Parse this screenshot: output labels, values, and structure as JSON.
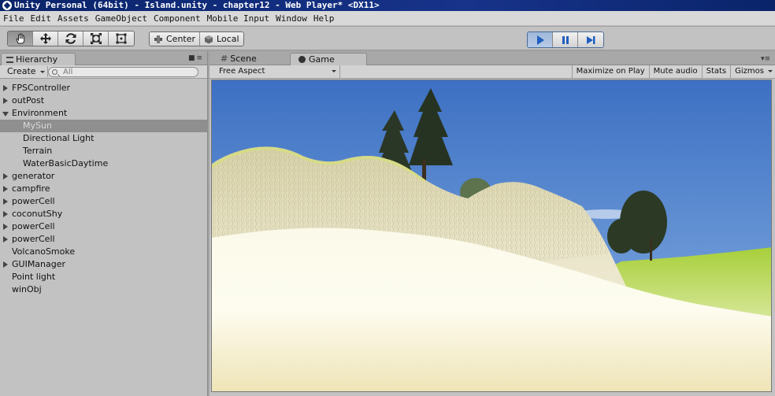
{
  "window": {
    "title": "Unity Personal (64bit) - Island.unity - chapter12 - Web Player* <DX11>"
  },
  "menubar": {
    "items": [
      "File",
      "Edit",
      "Assets",
      "GameObject",
      "Component",
      "Mobile Input",
      "Window",
      "Help"
    ]
  },
  "toolbar": {
    "tools": [
      "hand-icon",
      "move-icon",
      "rotate-icon",
      "scale-icon",
      "rect-icon"
    ],
    "pivot_label": "Center",
    "space_label": "Local",
    "play": [
      "play-icon",
      "pause-icon",
      "step-icon"
    ]
  },
  "hierarchy": {
    "tab_label": "Hierarchy",
    "create_label": "Create",
    "search_placeholder": "All",
    "items": [
      {
        "label": "FPSController",
        "fold": "closed"
      },
      {
        "label": "outPost",
        "fold": "closed"
      },
      {
        "label": "Environment",
        "fold": "open"
      },
      {
        "label": "MySun",
        "child": true,
        "selected": true
      },
      {
        "label": "Directional Light",
        "child": true
      },
      {
        "label": "Terrain",
        "child": true
      },
      {
        "label": "WaterBasicDaytime",
        "child": true
      },
      {
        "label": "generator",
        "fold": "closed"
      },
      {
        "label": "campfire",
        "fold": "closed"
      },
      {
        "label": "powerCell",
        "fold": "closed"
      },
      {
        "label": "coconutShy",
        "fold": "closed"
      },
      {
        "label": "powerCell",
        "fold": "closed"
      },
      {
        "label": "powerCell",
        "fold": "closed"
      },
      {
        "label": "VolcanoSmoke"
      },
      {
        "label": "GUIManager",
        "fold": "closed"
      },
      {
        "label": "Point light"
      },
      {
        "label": "winObj"
      }
    ]
  },
  "game": {
    "tabs": {
      "scene": "Scene",
      "game": "Game"
    },
    "aspect": "Free Aspect",
    "buttons": {
      "maximize": "Maximize on Play",
      "mute": "Mute audio",
      "stats": "Stats",
      "gizmos": "Gizmos"
    }
  },
  "colors": {
    "sky_top": "#3f73c4",
    "sky_bottom": "#8fb6e3",
    "sand": "#f7f4dc",
    "grass": "#b9d44a",
    "tree": "#2f3b22"
  }
}
